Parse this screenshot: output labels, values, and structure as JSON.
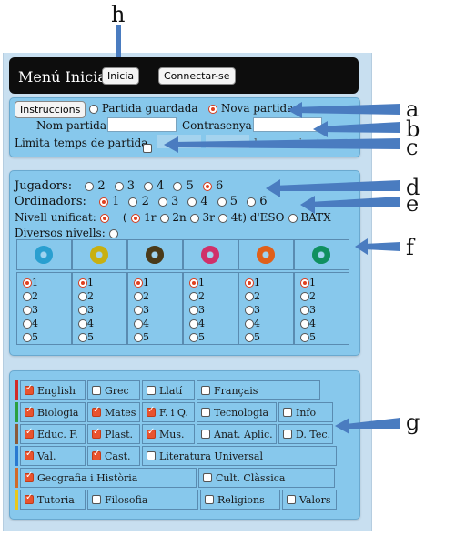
{
  "annotations": [
    "h",
    "a",
    "b",
    "c",
    "d",
    "e",
    "f",
    "g"
  ],
  "header": {
    "title": "Menú Inicial",
    "start_button": "Inicia",
    "connect_button": "Connectar-se"
  },
  "game": {
    "instructions_button": "Instruccions",
    "saved_game_label": "Partida guardada",
    "new_game_label": "Nova partida",
    "game_name_label": "Nom partida:",
    "password_label": "Contrasenya:",
    "time_limit_label": "Limita temps de partida",
    "time_unit_label": "hores:minuts"
  },
  "players": {
    "players_label": "Jugadors:",
    "player_options": [
      "2",
      "3",
      "4",
      "5",
      "6"
    ],
    "players_selected": "6",
    "computers_label": "Ordinadors:",
    "computer_options": [
      "1",
      "2",
      "3",
      "4",
      "5",
      "6"
    ],
    "computers_selected": "1",
    "unified_level_label": "Nivell unificat:",
    "level_paren_open": "(",
    "level_options": [
      "1r",
      "2n",
      "3r",
      "4t) d'ESO",
      "BATX"
    ],
    "level_selected": "1r",
    "diverse_levels_label": "Diversos nivells:",
    "token_colors": [
      "#2a9fd0",
      "#c8b010",
      "#4a3a1a",
      "#d0306a",
      "#e0601a",
      "#109060"
    ],
    "token_levels": [
      "1",
      "2",
      "3",
      "4",
      "5"
    ],
    "token_selected": "1"
  },
  "subjects": {
    "rows": [
      {
        "color": "#d02a2a",
        "items": [
          {
            "label": "English",
            "checked": true
          },
          {
            "label": "Grec",
            "checked": false
          },
          {
            "label": "Llatí",
            "checked": false
          },
          {
            "label": "Français",
            "checked": false
          }
        ]
      },
      {
        "color": "#2aa040",
        "items": [
          {
            "label": "Biologia",
            "checked": true
          },
          {
            "label": "Mates",
            "checked": true
          },
          {
            "label": "F. i Q.",
            "checked": true
          },
          {
            "label": "Tecnologia",
            "checked": false
          },
          {
            "label": "Info",
            "checked": false
          }
        ]
      },
      {
        "color": "#8a5a3a",
        "items": [
          {
            "label": "Educ. F.",
            "checked": true
          },
          {
            "label": "Plast.",
            "checked": true
          },
          {
            "label": "Mus.",
            "checked": true
          },
          {
            "label": "Anat. Aplic.",
            "checked": false
          },
          {
            "label": "D. Tec.",
            "checked": false
          }
        ]
      },
      {
        "color": "#2a7ad0",
        "items": [
          {
            "label": "Val.",
            "checked": true
          },
          {
            "label": "Cast.",
            "checked": true
          },
          {
            "label": "Literatura Universal",
            "checked": false
          }
        ]
      },
      {
        "color": "#d06a2a",
        "items": [
          {
            "label": "Geografia i Història",
            "checked": true
          },
          {
            "label": "Cult. Clàssica",
            "checked": false
          }
        ]
      },
      {
        "color": "#e8c81a",
        "items": [
          {
            "label": "Tutoria",
            "checked": true
          },
          {
            "label": "Filosofia",
            "checked": false
          },
          {
            "label": "Religions",
            "checked": false
          },
          {
            "label": "Valors",
            "checked": false
          }
        ]
      }
    ]
  },
  "colors": {
    "accent": "#e0401f",
    "card": "#87c8ec",
    "arrow": "#4a7cc0"
  }
}
